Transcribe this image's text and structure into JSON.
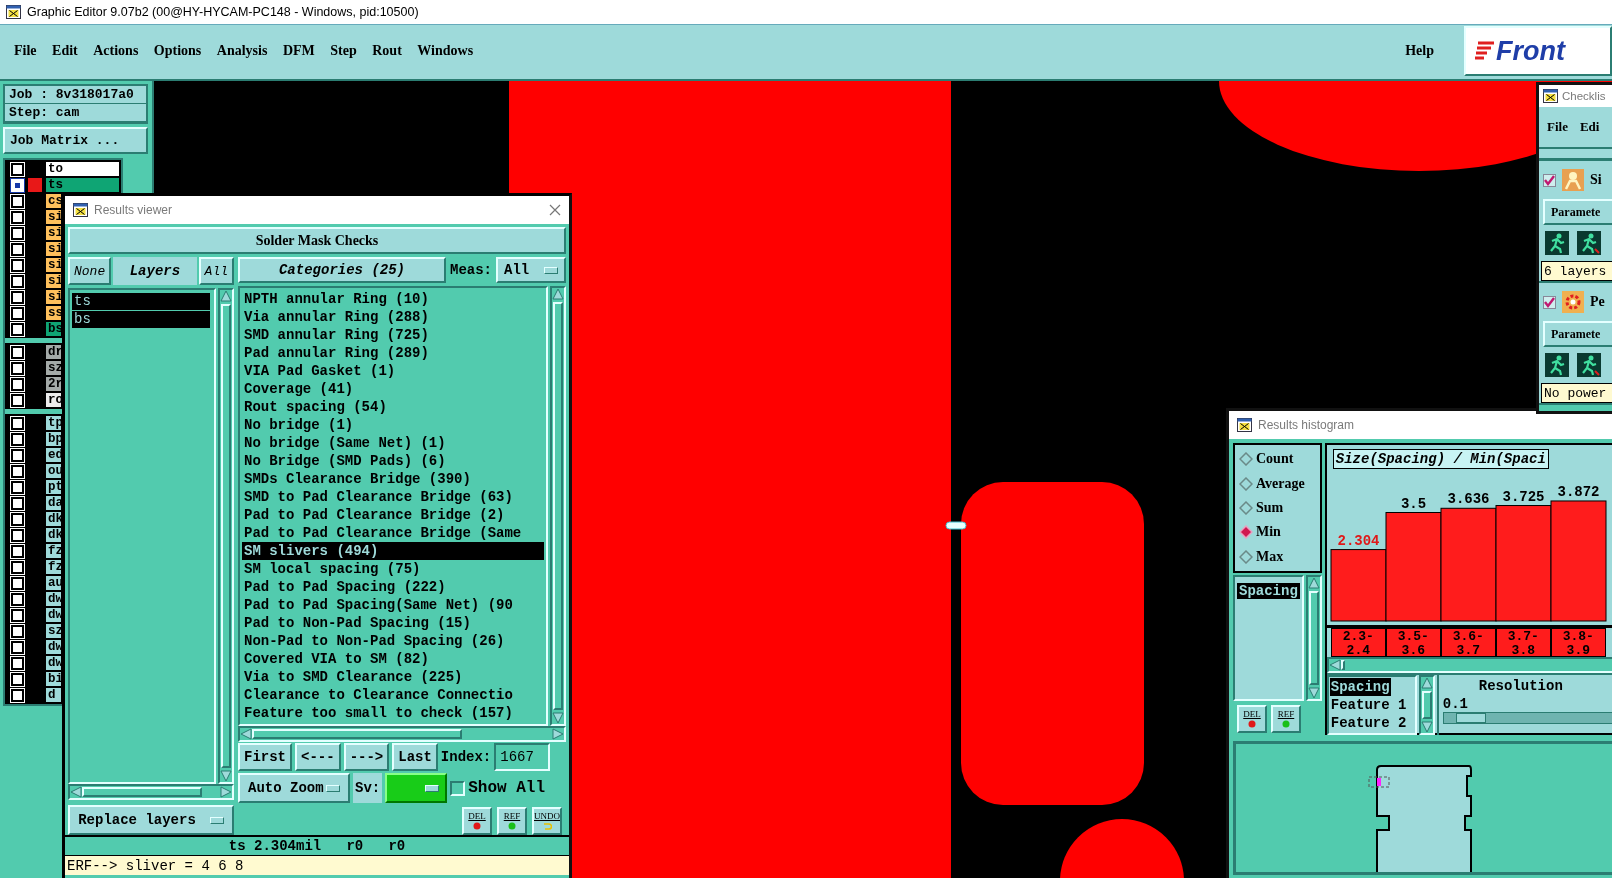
{
  "window": {
    "title": "Graphic Editor 9.07b2 (00@HY-HYCAM-PC148 - Windows, pid:10500)"
  },
  "menu": {
    "items": [
      "File",
      "Edit",
      "Actions",
      "Options",
      "Analysis",
      "DFM",
      "Step",
      "Rout",
      "Windows"
    ],
    "help": "Help",
    "logo": "Front"
  },
  "job_panel": {
    "job": "Job : 8v318017a0",
    "step": "Step: cam",
    "job_matrix": "Job Matrix ..."
  },
  "layer_groups": [
    {
      "items": [
        {
          "name": "to",
          "color": "#ffffff",
          "selected": false
        },
        {
          "name": "ts",
          "color": "#0fa574",
          "selected": true
        },
        {
          "name": "cs",
          "color": "#ffc05c",
          "selected": false
        },
        {
          "name": "si",
          "color": "#ffc05c",
          "selected": false
        },
        {
          "name": "si",
          "color": "#ffc05c",
          "selected": false
        },
        {
          "name": "si",
          "color": "#ffc05c",
          "selected": false
        },
        {
          "name": "si",
          "color": "#ffc05c",
          "selected": false
        },
        {
          "name": "si",
          "color": "#ffc05c",
          "selected": false
        },
        {
          "name": "si",
          "color": "#ffc05c",
          "selected": false
        },
        {
          "name": "ss",
          "color": "#ffc05c",
          "selected": false
        },
        {
          "name": "bs",
          "color": "#0fa574",
          "selected": false
        }
      ]
    },
    {
      "items": [
        {
          "name": "dr",
          "color": "#a4aaa8",
          "selected": false
        },
        {
          "name": "sz",
          "color": "#a4aaa8",
          "selected": false
        },
        {
          "name": "2r",
          "color": "#a4aaa8",
          "selected": false
        },
        {
          "name": "ro",
          "color": "#ececec",
          "selected": false
        }
      ]
    },
    {
      "items": [
        {
          "name": "tp",
          "color": "#9edada",
          "selected": false
        },
        {
          "name": "bp",
          "color": "#9edada",
          "selected": false
        },
        {
          "name": "ed",
          "color": "#9edada",
          "selected": false
        },
        {
          "name": "ou",
          "color": "#9edada",
          "selected": false
        },
        {
          "name": "pt",
          "color": "#9edada",
          "selected": false
        },
        {
          "name": "da",
          "color": "#9edada",
          "selected": false
        },
        {
          "name": "dk",
          "color": "#9edada",
          "selected": false
        },
        {
          "name": "dk",
          "color": "#9edada",
          "selected": false
        },
        {
          "name": "fz",
          "color": "#9edada",
          "selected": false
        },
        {
          "name": "fz",
          "color": "#9edada",
          "selected": false
        },
        {
          "name": "au",
          "color": "#9edada",
          "selected": false
        },
        {
          "name": "dw",
          "color": "#9edada",
          "selected": false
        },
        {
          "name": "dw",
          "color": "#9edada",
          "selected": false
        },
        {
          "name": "sz",
          "color": "#9edada",
          "selected": false
        },
        {
          "name": "dw",
          "color": "#9edada",
          "selected": false
        },
        {
          "name": "dw",
          "color": "#9edada",
          "selected": false
        },
        {
          "name": "bi",
          "color": "#9edada",
          "selected": false
        },
        {
          "name": "d",
          "color": "#9edada",
          "selected": false
        }
      ]
    }
  ],
  "results_viewer": {
    "title": "Results viewer",
    "heading": "Solder Mask Checks",
    "none_button": "None",
    "layers_label": "Layers",
    "all_button": "All",
    "layers": [
      {
        "name": "ts",
        "selected": true
      },
      {
        "name": "bs",
        "selected": true
      }
    ],
    "categories_button": "Categories (25)",
    "meas_label": "Meas:",
    "meas_value": "All",
    "categories": [
      {
        "label": "NPTH annular Ring (10)",
        "selected": false
      },
      {
        "label": "Via annular Ring (288)",
        "selected": false
      },
      {
        "label": "SMD annular Ring (725)",
        "selected": false
      },
      {
        "label": "Pad annular Ring (289)",
        "selected": false
      },
      {
        "label": "VIA Pad Gasket (1)",
        "selected": false
      },
      {
        "label": "Coverage (41)",
        "selected": false
      },
      {
        "label": "Rout spacing (54)",
        "selected": false
      },
      {
        "label": "No bridge (1)",
        "selected": false
      },
      {
        "label": "No bridge (Same Net) (1)",
        "selected": false
      },
      {
        "label": "No Bridge (SMD Pads) (6)",
        "selected": false
      },
      {
        "label": "SMDs Clearance Bridge (390)",
        "selected": false
      },
      {
        "label": "SMD to Pad Clearance Bridge (63)",
        "selected": false
      },
      {
        "label": "Pad to Pad Clearance Bridge (2)",
        "selected": false
      },
      {
        "label": "Pad to Pad Clearance Bridge (Same",
        "selected": false
      },
      {
        "label": "SM slivers (494)",
        "selected": true
      },
      {
        "label": "SM local spacing (75)",
        "selected": false
      },
      {
        "label": "Pad to Pad Spacing (222)",
        "selected": false
      },
      {
        "label": "Pad to Pad Spacing(Same Net) (90",
        "selected": false
      },
      {
        "label": "Pad to Non-Pad Spacing (15)",
        "selected": false
      },
      {
        "label": "Non-Pad to Non-Pad Spacing (26)",
        "selected": false
      },
      {
        "label": "Covered VIA to SM (82)",
        "selected": false
      },
      {
        "label": "Via to SMD Clearance (225)",
        "selected": false
      },
      {
        "label": "Clearance to Clearance Connectio",
        "selected": false
      },
      {
        "label": "Feature too small to check (157)",
        "selected": false
      }
    ],
    "nav": [
      "First",
      "<---",
      "--->",
      "Last"
    ],
    "index_label": "Index:",
    "index_value": "1667",
    "zoom_mode": "Auto Zoom",
    "sv_label": "Sv:",
    "show_all": {
      "label": "Show All",
      "checked": false
    },
    "layer_mode": "Replace layers",
    "tools": [
      "DEL",
      "REF",
      "UNDO"
    ],
    "status": "ts 2.304mil   r0   r0",
    "log": "ERF--> sliver = 4 6 8"
  },
  "histogram": {
    "title": "Results histogram",
    "modes": [
      {
        "label": "Count",
        "selected": false
      },
      {
        "label": "Average",
        "selected": false
      },
      {
        "label": "Sum",
        "selected": false
      },
      {
        "label": "Min",
        "selected": true
      },
      {
        "label": "Max",
        "selected": false
      }
    ],
    "measures": [
      {
        "label": "Spacing",
        "selected": true
      }
    ],
    "tools": [
      "DEL",
      "REF"
    ],
    "chart_data": {
      "type": "bar",
      "title": "Size(Spacing) / Min(Spaci",
      "categories": [
        "2.3-2.4",
        "3.5-3.6",
        "3.6-3.7",
        "3.7-3.8",
        "3.8-3.9"
      ],
      "values": [
        2.304,
        3.5,
        3.636,
        3.725,
        3.872
      ],
      "data_labels": true
    },
    "fields": [
      {
        "label": "Spacing",
        "selected": true
      },
      {
        "label": "Feature 1",
        "selected": false
      },
      {
        "label": "Feature 2",
        "selected": false
      }
    ],
    "resolution": {
      "label": "Resolution",
      "value": "0.1",
      "level": 0.06
    }
  },
  "checklist": {
    "title": "Checklis",
    "menu": [
      "File",
      "Edi"
    ],
    "checks": [
      {
        "name": "Si",
        "checked": true,
        "button": "Paramete",
        "summary": "6 layers"
      },
      {
        "name": "Pe",
        "checked": true,
        "button": "Paramete",
        "summary": "No power"
      }
    ]
  }
}
